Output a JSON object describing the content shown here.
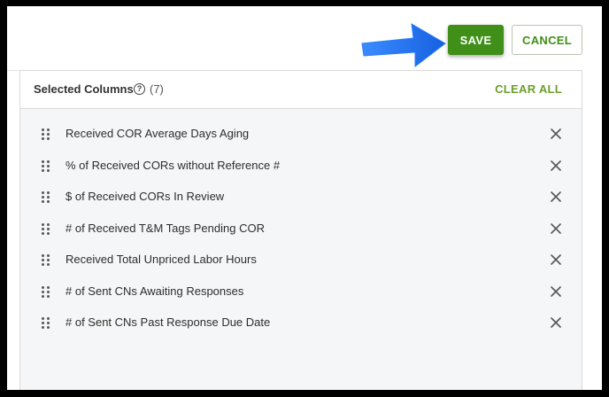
{
  "toolbar": {
    "save_label": "SAVE",
    "cancel_label": "CANCEL"
  },
  "panel": {
    "title": "Selected Columns",
    "count": "(7)",
    "clear_all_label": "CLEAR ALL",
    "help_icon": "question-circle-icon",
    "items": [
      {
        "label": "Received COR Average Days Aging"
      },
      {
        "label": "% of Received CORs without Reference #"
      },
      {
        "label": "$ of Received CORs In Review"
      },
      {
        "label": "# of Received T&M Tags Pending COR"
      },
      {
        "label": "Received Total Unpriced Labor Hours"
      },
      {
        "label": "# of Sent CNs Awaiting Responses"
      },
      {
        "label": "# of Sent CNs Past Response Due Date"
      }
    ]
  },
  "colors": {
    "accent": "#3f8f18",
    "clear_all": "#6c9e2b",
    "arrow": "#1f6fe8",
    "list_background": "#f5f6f7"
  }
}
